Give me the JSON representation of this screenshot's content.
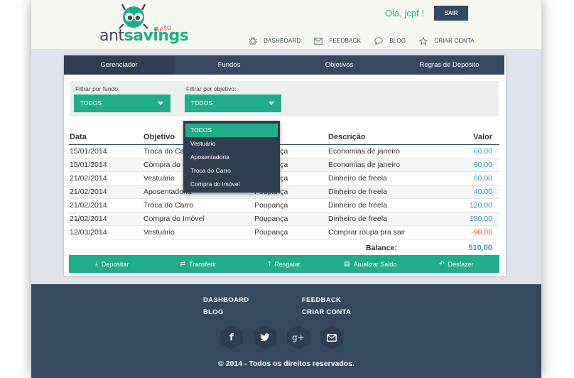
{
  "header": {
    "logo_text_1": "ant",
    "logo_text_2": "savings",
    "beta": "Beta",
    "greeting": "Olá, jcpf !",
    "logout_label": "SAIR",
    "nav": [
      {
        "label": "DASHBOARD",
        "icon": "gear-icon"
      },
      {
        "label": "FEEDBACK",
        "icon": "envelope-icon"
      },
      {
        "label": "BLOG",
        "icon": "chat-icon"
      },
      {
        "label": "CRIAR CONTA",
        "icon": "star-icon"
      }
    ]
  },
  "tabs": [
    {
      "label": "Gerenciador",
      "active": true
    },
    {
      "label": "Fundos",
      "active": false
    },
    {
      "label": "Objetivos",
      "active": false
    },
    {
      "label": "Regras de Depósito",
      "active": false
    }
  ],
  "filters": {
    "fund_label": "Filtrar por fundo:",
    "fund_value": "TODOS",
    "objective_label": "Filtrar por objetivo:",
    "objective_value": "TODOS"
  },
  "objective_dropdown": {
    "options": [
      "TODOS",
      "Vestuário",
      "Aposentadoria",
      "Troca do Carro",
      "Compra do Imóvel"
    ],
    "selected": "TODOS"
  },
  "table": {
    "headers": {
      "data": "Data",
      "objetivo": "Objetivo",
      "descricao": "Descrição",
      "valor": "Valor"
    },
    "rows": [
      {
        "data": "15/01/2014",
        "objetivo": "Troca do Carro",
        "tipo": "Poupança",
        "descricao": "Economias de janeiro",
        "valor": "60,00",
        "sign": "pos"
      },
      {
        "data": "15/01/2014",
        "objetivo": "Compra do Imóvel",
        "tipo": "Poupança",
        "descricao": "Economias de janeiro",
        "valor": "90,00",
        "sign": "pos"
      },
      {
        "data": "21/02/2014",
        "objetivo": "Vestuário",
        "tipo": "Poupança",
        "descricao": "Dinheiro de freela",
        "valor": "60,00",
        "sign": "pos"
      },
      {
        "data": "21/02/2014",
        "objetivo": "Aposentadoria",
        "tipo": "Poupança",
        "descricao": "Dinheiro de freela",
        "valor": "40,00",
        "sign": "pos"
      },
      {
        "data": "21/02/2014",
        "objetivo": "Troca do Carro",
        "tipo": "Poupança",
        "descricao": "Dinheiro de freela",
        "valor": "120,00",
        "sign": "pos"
      },
      {
        "data": "21/02/2014",
        "objetivo": "Compra do Imóvel",
        "tipo": "Poupança",
        "descricao": "Dinheiro de freela",
        "valor": "180,00",
        "sign": "pos"
      },
      {
        "data": "12/03/2014",
        "objetivo": "Vestuário",
        "tipo": "Poupança",
        "descricao": "Comprar roupa pra sair",
        "valor": "-90,00",
        "sign": "neg"
      }
    ],
    "balance_label": "Balance:",
    "balance_value": "510,00"
  },
  "actions": [
    {
      "label": "Depositar",
      "icon": "deposit-icon"
    },
    {
      "label": "Transferir",
      "icon": "transfer-icon"
    },
    {
      "label": "Resgatar",
      "icon": "withdraw-icon"
    },
    {
      "label": "Atualizar Saldo",
      "icon": "update-icon"
    },
    {
      "label": "Desfazer",
      "icon": "undo-icon"
    }
  ],
  "footer": {
    "links_col1": [
      "DASHBOARD",
      "BLOG"
    ],
    "links_col2": [
      "FEEDBACK",
      "CRIAR CONTA"
    ],
    "social": [
      {
        "glyph": "f",
        "icon": "facebook-icon"
      },
      {
        "glyph": "🐦",
        "icon": "twitter-icon"
      },
      {
        "glyph": "g+",
        "icon": "google-plus-icon"
      },
      {
        "glyph": "✉",
        "icon": "email-icon"
      }
    ],
    "copyright": "© 2014 - Todos os direitos reservados."
  },
  "colors": {
    "accent": "#1fae89",
    "dark": "#34495e",
    "positive": "#3a8ecf",
    "negative": "#e2503a"
  }
}
